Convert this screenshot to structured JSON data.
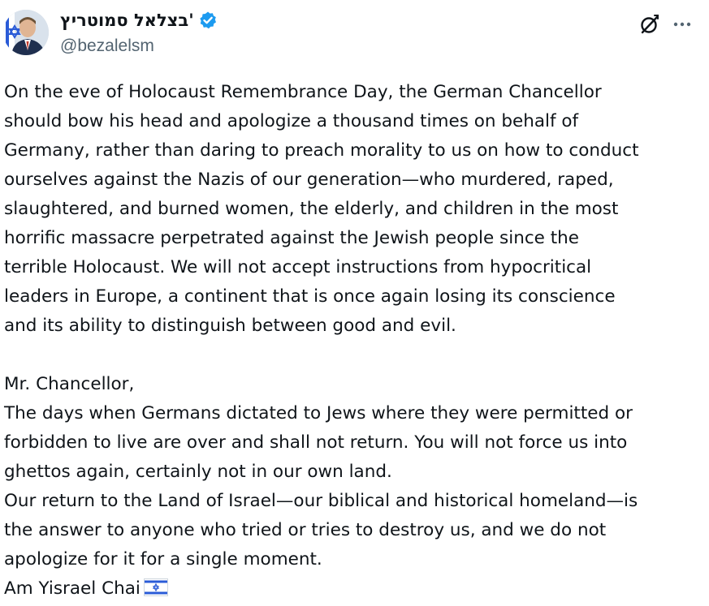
{
  "author": {
    "display_name": "בצלאל סמוטריץ'",
    "handle": "@bezalelsm",
    "verified": true,
    "verified_badge_color": "#1d9bf0",
    "avatar_icon": "profile-photo"
  },
  "header_actions": {
    "grok_icon": "grok-icon",
    "more_icon": "more-options-icon"
  },
  "tweet": {
    "lines_paragraph_1": [
      "On the eve of Holocaust Remembrance Day, the German Chancellor",
      "should bow his head and apologize a thousand times on behalf of",
      "Germany, rather than daring to preach morality to us on how to conduct",
      "ourselves against the Nazis of our generation—who murdered, raped,",
      "slaughtered, and burned women, the elderly, and children in the most",
      "horrific massacre perpetrated against the Jewish people since the",
      "terrible Holocaust. We will not accept instructions from hypocritical",
      "leaders in Europe, a continent that is once again losing its conscience",
      "and its ability to distinguish between good and evil."
    ],
    "lines_paragraph_2": [
      "Mr. Chancellor,",
      "The days when Germans dictated to Jews where they were permitted or",
      "forbidden to live are over and shall not return. You will not force us into",
      "ghettos again, certainly not in our own land.",
      "Our return to the Land of Israel—our biblical and historical homeland—is",
      "the answer to anyone who tried or tries to destroy us, and we do not",
      "apologize for it for a single moment."
    ],
    "closing_line": "Am Yisrael Chai",
    "closing_emoji": "israel-flag-icon"
  }
}
